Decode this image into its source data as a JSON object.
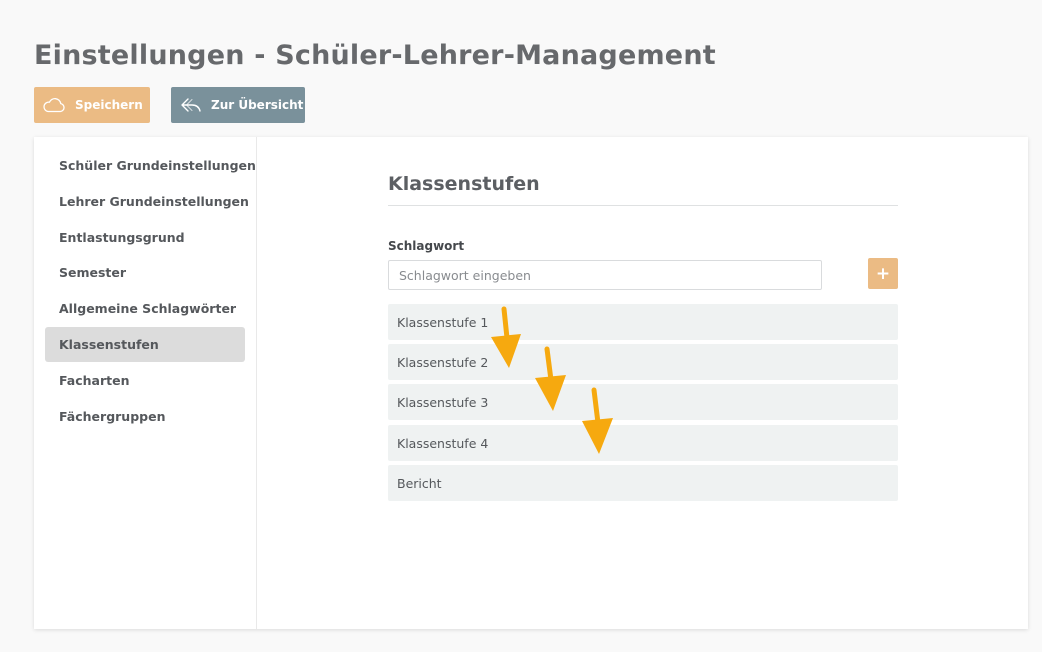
{
  "header": {
    "title": "Einstellungen - Schüler-Lehrer-Management"
  },
  "toolbar": {
    "save_label": "Speichern",
    "save_icon": "cloud-icon",
    "back_label": "Zur Übersicht",
    "back_icon": "reply-arrow-icon"
  },
  "sidebar": {
    "items": [
      {
        "label": "Schüler Grundeinstellungen"
      },
      {
        "label": "Lehrer Grundeinstellungen"
      },
      {
        "label": "Entlastungsgrund"
      },
      {
        "label": "Semester"
      },
      {
        "label": "Allgemeine Schlagwörter"
      },
      {
        "label": "Klassenstufen",
        "active": true
      },
      {
        "label": "Facharten"
      },
      {
        "label": "Fächergruppen"
      }
    ]
  },
  "main": {
    "section_title": "Klassenstufen",
    "field_label": "Schlagwort",
    "input_placeholder": "Schlagwort eingeben",
    "input_value": "",
    "add_button_label": "+",
    "items": [
      {
        "label": "Klassenstufe 1"
      },
      {
        "label": "Klassenstufe 2"
      },
      {
        "label": "Klassenstufe 3"
      },
      {
        "label": "Klassenstufe 4"
      },
      {
        "label": "Bericht"
      }
    ]
  },
  "annotations": {
    "arrow_color": "#f6a90f",
    "arrow_count": 3
  },
  "colors": {
    "accent": "#ebbb84",
    "secondary": "#7a919b",
    "active_item_bg": "#dcdcdc",
    "list_item_bg": "#eff2f2"
  }
}
